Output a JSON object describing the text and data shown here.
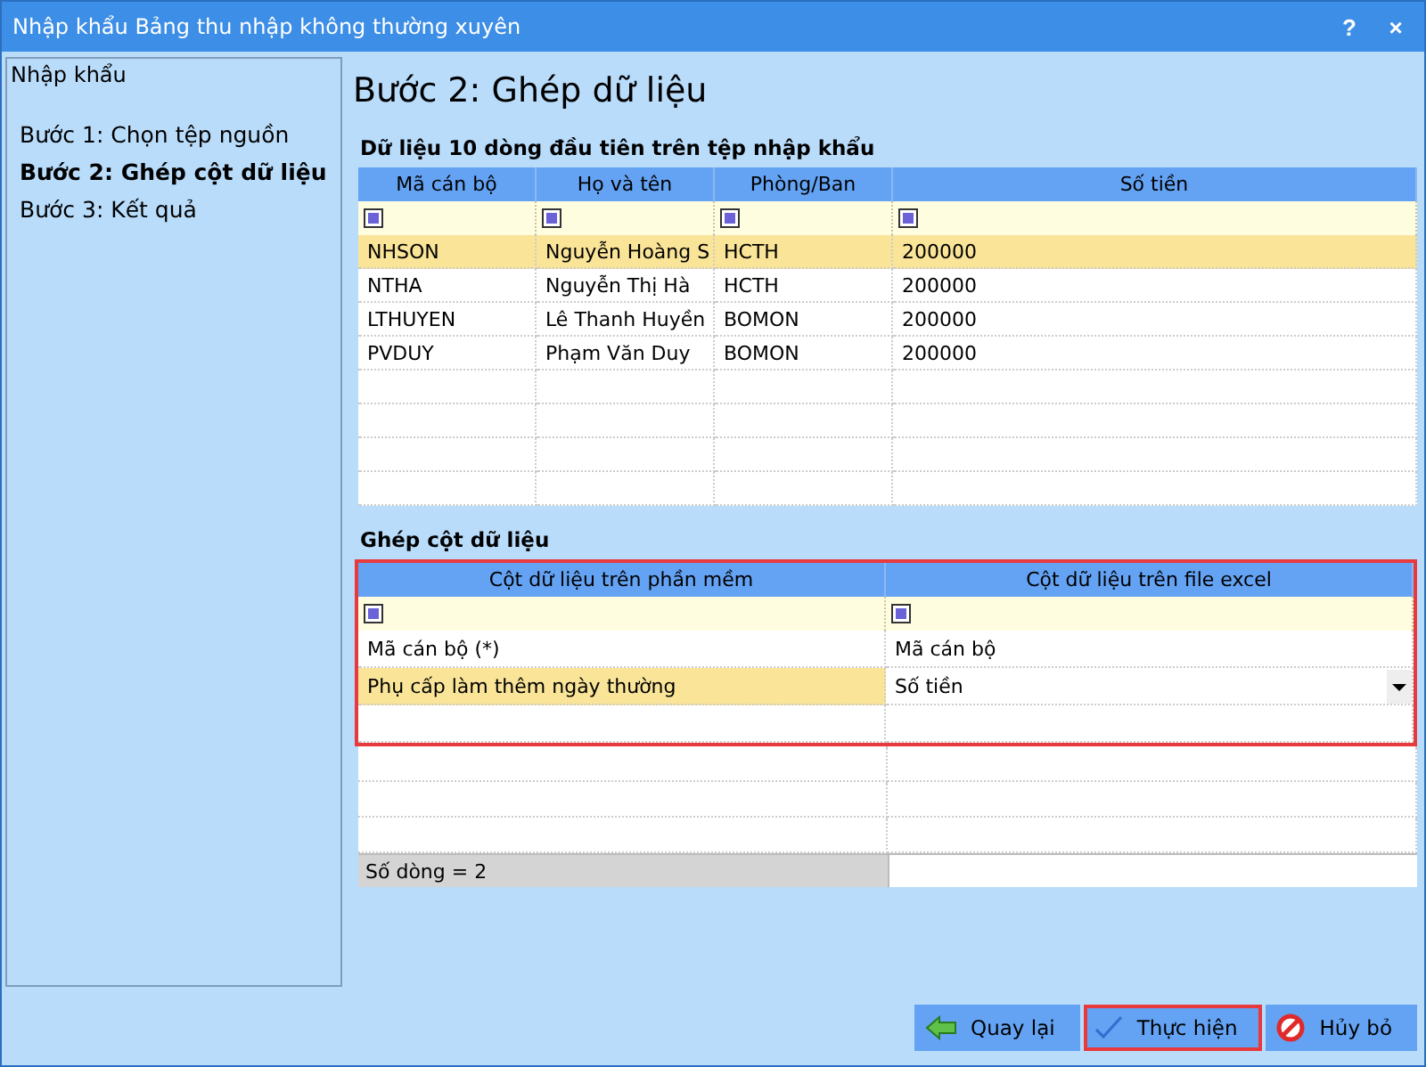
{
  "window": {
    "title": "Nhập khẩu Bảng thu nhập không thường xuyên",
    "help": "?",
    "close": "×"
  },
  "sidebar": {
    "title": "Nhập khẩu",
    "items": [
      {
        "label": "Bước 1: Chọn tệp nguồn",
        "selected": false
      },
      {
        "label": "Bước 2: Ghép cột dữ liệu",
        "selected": true
      },
      {
        "label": "Bước 3: Kết quả",
        "selected": false
      }
    ]
  },
  "heading": "Bước 2: Ghép dữ liệu",
  "preview": {
    "title": "Dữ liệu 10 dòng đầu tiên trên tệp nhập khẩu",
    "columns": [
      "Mã cán bộ",
      "Họ và tên",
      "Phòng/Ban",
      "Số tiền"
    ],
    "rows": [
      {
        "cells": [
          "NHSON",
          "Nguyễn Hoàng S",
          "HCTH",
          "200000"
        ],
        "selected": true
      },
      {
        "cells": [
          "NTHA",
          "Nguyễn Thị Hà",
          "HCTH",
          "200000"
        ],
        "selected": false
      },
      {
        "cells": [
          "LTHUYEN",
          "Lê Thanh Huyền",
          "BOMON",
          "200000"
        ],
        "selected": false
      },
      {
        "cells": [
          "PVDUY",
          "Phạm Văn Duy",
          "BOMON",
          "200000"
        ],
        "selected": false
      }
    ]
  },
  "mapping": {
    "title": "Ghép cột dữ liệu",
    "highlighted": true,
    "columns": [
      "Cột dữ liệu trên phần mềm",
      "Cột dữ liệu trên file excel"
    ],
    "rows": [
      {
        "cells": [
          "Mã cán bộ (*)",
          "Mã cán bộ"
        ],
        "selected": false
      },
      {
        "cells": [
          "Phụ cấp làm thêm ngày thường",
          "Số tiền"
        ],
        "selected": true
      }
    ],
    "footer": "Số dòng = 2"
  },
  "buttons": [
    {
      "kind": "back",
      "label": "Quay lại",
      "highlighted": false
    },
    {
      "kind": "run",
      "label": "Thực hiện",
      "highlighted": true
    },
    {
      "kind": "cancel",
      "label": "Hủy bỏ",
      "highlighted": false
    }
  ]
}
